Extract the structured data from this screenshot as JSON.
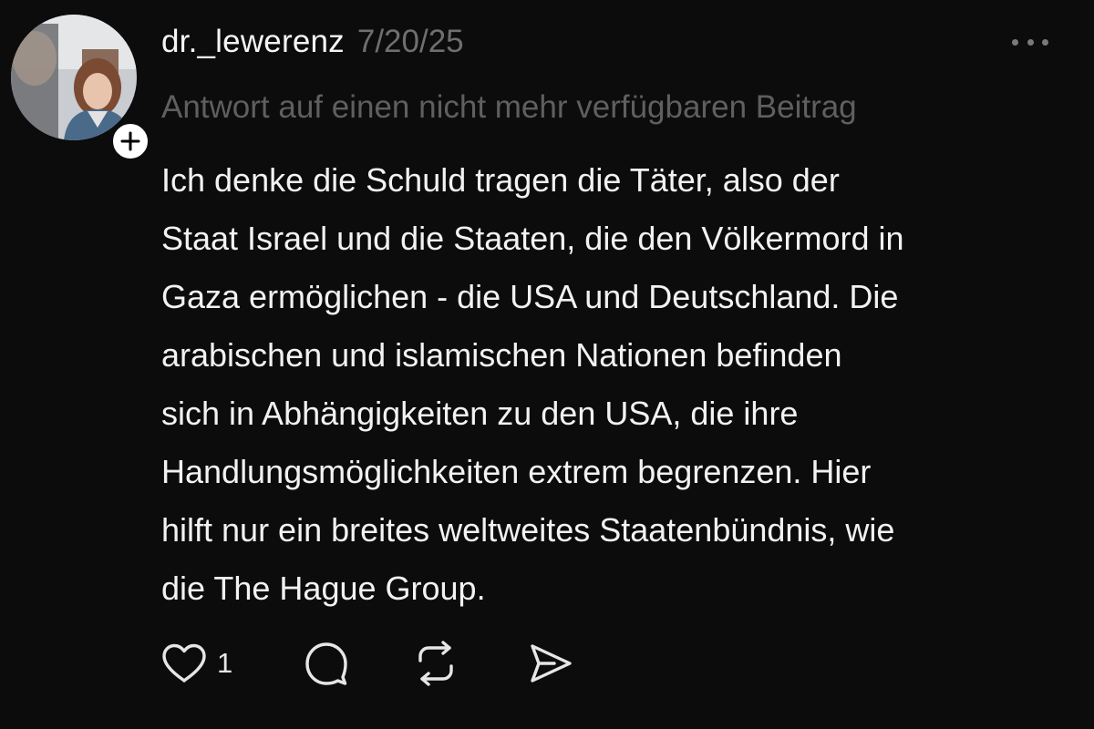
{
  "post": {
    "username": "dr._lewerenz",
    "timestamp": "7/20/25",
    "reply_context": "Antwort auf einen nicht mehr verfügbaren Beitrag",
    "body_lines": [
      "Ich denke die Schuld tragen die Täter, also der",
      "Staat Israel und die Staaten, die den Völkermord in",
      "Gaza ermöglichen - die USA und Deutschland. Die",
      "arabischen und islamischen Nationen befinden",
      "sich in Abhängigkeiten zu den USA, die ihre",
      "Handlungsmöglichkeiten extrem begrenzen. Hier",
      "hilft nur ein breites weltweites Staatenbündnis, wie",
      "die The Hague Group."
    ]
  },
  "actions": {
    "like_count": "1",
    "like_icon": "heart-icon",
    "reply_icon": "speech-bubble-icon",
    "repost_icon": "repost-icon",
    "share_icon": "send-icon"
  },
  "icons": {
    "more": "more-horizontal-icon",
    "follow": "plus-icon"
  },
  "colors": {
    "background": "#0c0c0c",
    "text_primary": "#f2f2f2",
    "text_muted": "#6f6f6f"
  }
}
